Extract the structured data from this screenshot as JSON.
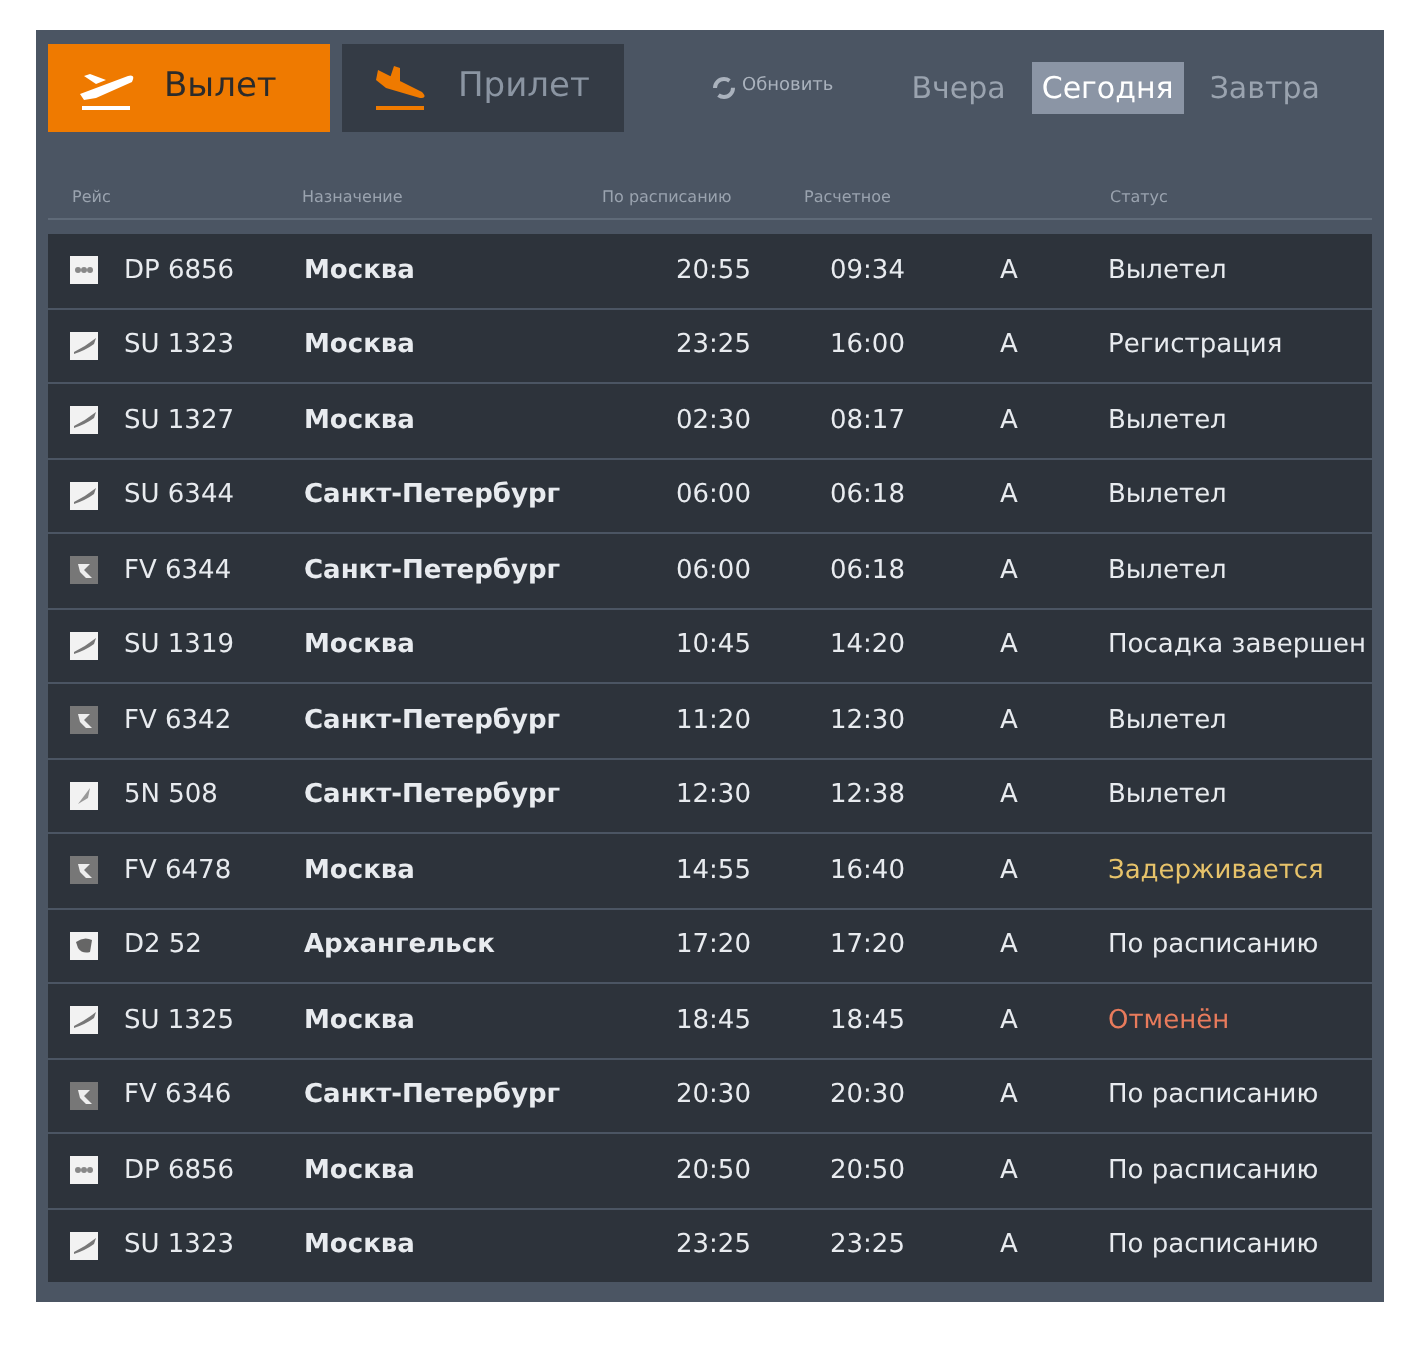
{
  "tabs": [
    {
      "label": "Вылет",
      "kind": "departure",
      "selected": true
    },
    {
      "label": "Прилет",
      "kind": "arrival",
      "selected": false
    }
  ],
  "refresh": "Обновить",
  "days": [
    {
      "label": "Вчера",
      "selected": false
    },
    {
      "label": "Сегодня",
      "selected": true
    },
    {
      "label": "Завтра",
      "selected": false
    }
  ],
  "columns": [
    "Рейс",
    "Назначение",
    "По расписанию",
    "Расчетное",
    "Статус"
  ],
  "rows": [
    {
      "kind": "dots",
      "flight": "DP 6856",
      "destination": "Москва",
      "scheduled": "20:55",
      "estimated": "09:34",
      "terminal": "A",
      "status": "Вылетел",
      "color": "#e8ebef"
    },
    {
      "kind": "swoosh",
      "flight": "SU 1323",
      "destination": "Москва",
      "scheduled": "23:25",
      "estimated": "16:00",
      "terminal": "A",
      "status": "Регистрация",
      "color": "#e8ebef"
    },
    {
      "kind": "swoosh",
      "flight": "SU 1327",
      "destination": "Москва",
      "scheduled": "02:30",
      "estimated": "08:17",
      "terminal": "A",
      "status": "Вылетел",
      "color": "#e8ebef"
    },
    {
      "kind": "swoosh",
      "flight": "SU 6344",
      "destination": "Санкт-Петербург",
      "scheduled": "06:00",
      "estimated": "06:18",
      "terminal": "A",
      "status": "Вылетел",
      "color": "#e8ebef"
    },
    {
      "kind": "r",
      "flight": "FV 6344",
      "destination": "Санкт-Петербург",
      "scheduled": "06:00",
      "estimated": "06:18",
      "terminal": "A",
      "status": "Вылетел",
      "color": "#e8ebef"
    },
    {
      "kind": "swoosh",
      "flight": "SU 1319",
      "destination": "Москва",
      "scheduled": "10:45",
      "estimated": "14:20",
      "terminal": "A",
      "status": "Посадка завершен",
      "color": "#e8ebef"
    },
    {
      "kind": "r",
      "flight": "FV 6342",
      "destination": "Санкт-Петербург",
      "scheduled": "11:20",
      "estimated": "12:30",
      "terminal": "A",
      "status": "Вылетел",
      "color": "#e8ebef"
    },
    {
      "kind": "feather",
      "flight": "5N 508",
      "destination": "Санкт-Петербург",
      "scheduled": "12:30",
      "estimated": "12:38",
      "terminal": "A",
      "status": "Вылетел",
      "color": "#e8ebef"
    },
    {
      "kind": "r",
      "flight": "FV 6478",
      "destination": "Москва",
      "scheduled": "14:55",
      "estimated": "16:40",
      "terminal": "A",
      "status": "Задерживается",
      "color": "#e7c36a"
    },
    {
      "kind": "ring",
      "flight": "D2 52",
      "destination": "Архангельск",
      "scheduled": "17:20",
      "estimated": "17:20",
      "terminal": "A",
      "status": "По расписанию",
      "color": "#e8ebef"
    },
    {
      "kind": "swoosh",
      "flight": "SU 1325",
      "destination": "Москва",
      "scheduled": "18:45",
      "estimated": "18:45",
      "terminal": "A",
      "status": "Отменён",
      "color": "#e87b5c"
    },
    {
      "kind": "r",
      "flight": "FV 6346",
      "destination": "Санкт-Петербург",
      "scheduled": "20:30",
      "estimated": "20:30",
      "terminal": "A",
      "status": "По расписанию",
      "color": "#e8ebef"
    },
    {
      "kind": "dots",
      "flight": "DP 6856",
      "destination": "Москва",
      "scheduled": "20:50",
      "estimated": "20:50",
      "terminal": "A",
      "status": "По расписанию",
      "color": "#e8ebef"
    },
    {
      "kind": "swoosh",
      "flight": "SU 1323",
      "destination": "Москва",
      "scheduled": "23:25",
      "estimated": "23:25",
      "terminal": "A",
      "status": "По расписанию",
      "color": "#e8ebef"
    }
  ]
}
